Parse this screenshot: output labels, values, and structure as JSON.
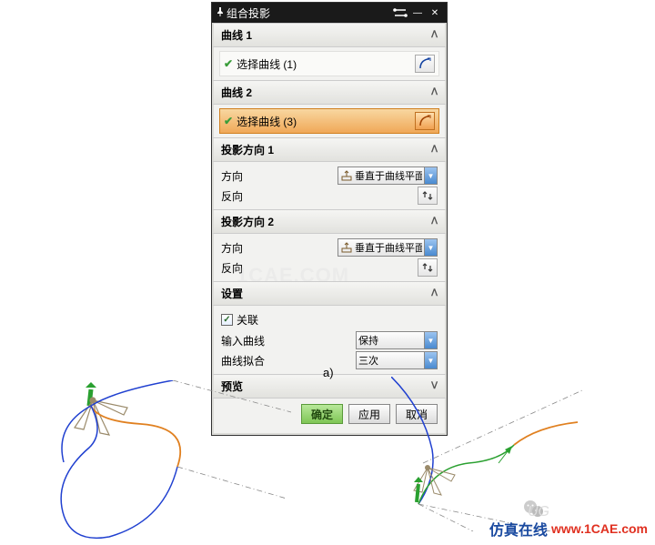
{
  "titlebar": {
    "title": "组合投影"
  },
  "sections": {
    "curve1": {
      "header": "曲线 1",
      "select": "选择曲线 (1)"
    },
    "curve2": {
      "header": "曲线 2",
      "select": "选择曲线 (3)"
    },
    "projdir1": {
      "header": "投影方向 1",
      "dir_label": "方向",
      "dir_value": "垂直于曲线平面",
      "reverse_label": "反向"
    },
    "projdir2": {
      "header": "投影方向 2",
      "dir_label": "方向",
      "dir_value": "垂直于曲线平面",
      "reverse_label": "反向"
    },
    "settings": {
      "header": "设置",
      "assoc_label": "关联",
      "assoc_checked": true,
      "input_curve_label": "输入曲线",
      "input_curve_value": "保持",
      "fit_label": "曲线拟合",
      "fit_value": "三次"
    },
    "preview": {
      "header": "预览"
    }
  },
  "buttons": {
    "ok": "确定",
    "apply": "应用",
    "cancel": "取消"
  },
  "figure_label": "a)",
  "watermark": "1CAE.COM",
  "footer": {
    "cn": "仿真在线",
    "en": "www.1CAE.com"
  }
}
